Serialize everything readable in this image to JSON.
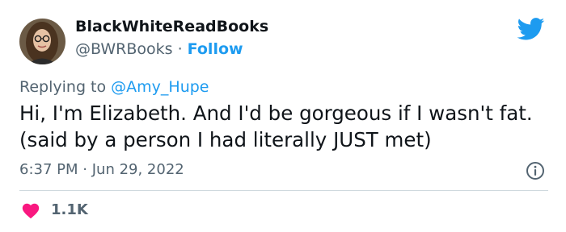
{
  "author": {
    "display_name": "BlackWhiteReadBooks",
    "handle": "@BWRBooks",
    "separator": "·",
    "follow_label": "Follow",
    "avatar_icon": "avatar-photo"
  },
  "brand": {
    "icon": "twitter-bird-icon",
    "color": "#1d9bf0"
  },
  "tweet": {
    "reply_prefix": "Replying to",
    "reply_to": "@Amy_Hupe",
    "text": "Hi, I'm Elizabeth. And I'd be gorgeous if I wasn't fat. (said by a person I had literally JUST met)",
    "time": "6:37 PM",
    "separator": "·",
    "date": "Jun 29, 2022"
  },
  "engagement": {
    "likes": "1.1K",
    "like_icon": "heart-icon",
    "like_color": "#f91880",
    "info_icon": "info-icon"
  },
  "colors": {
    "text": "#0f1419",
    "secondary": "#536471",
    "link": "#1d9bf0",
    "divider": "#cfd9de"
  }
}
